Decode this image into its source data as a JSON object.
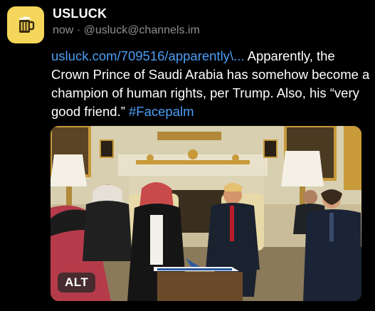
{
  "post": {
    "author_name": "USLUCK",
    "timestamp": "now",
    "separator": "·",
    "handle": "@usluck@channels.im",
    "link_text": "usluck.com/709516/apparently\\...",
    "body_text": " Apparently, the Crown Prince of Saudi Arabia has somehow become a champion of human rights, per Trump. Also, his “very good friend.” ",
    "hashtag": "#Facepalm",
    "avatar_icon": "beer-mug-icon"
  },
  "media": {
    "alt_label": "ALT"
  },
  "colors": {
    "background": "#000000",
    "link": "#4a9ff5",
    "meta": "#8e8e93",
    "avatar_bg": "#f5d65a"
  }
}
